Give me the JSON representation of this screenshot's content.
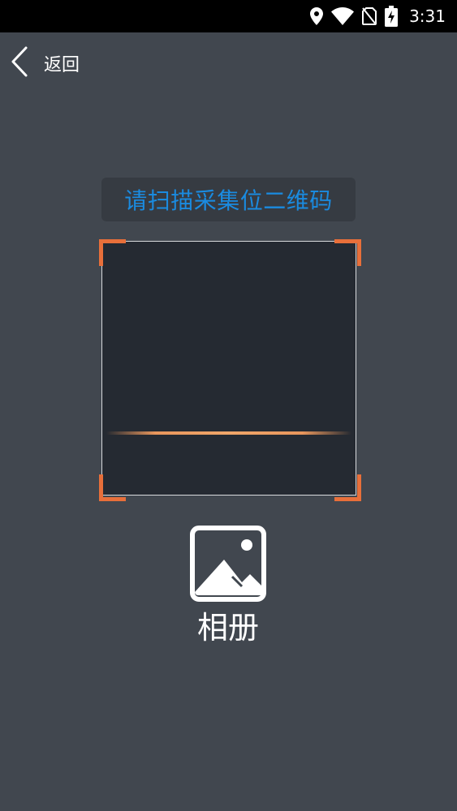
{
  "status_bar": {
    "time": "3:31",
    "icons": [
      "location-icon",
      "wifi-icon",
      "no-sim-icon",
      "battery-charging-icon"
    ]
  },
  "nav": {
    "back_label": "返回",
    "back_icon": "chevron-left-icon"
  },
  "scanner": {
    "prompt": "请扫描采集位二维码",
    "prompt_color": "#1a8be0",
    "corner_color": "#e86f3a",
    "scan_line_color": "#e8965c"
  },
  "album": {
    "label": "相册",
    "icon": "image-icon"
  }
}
